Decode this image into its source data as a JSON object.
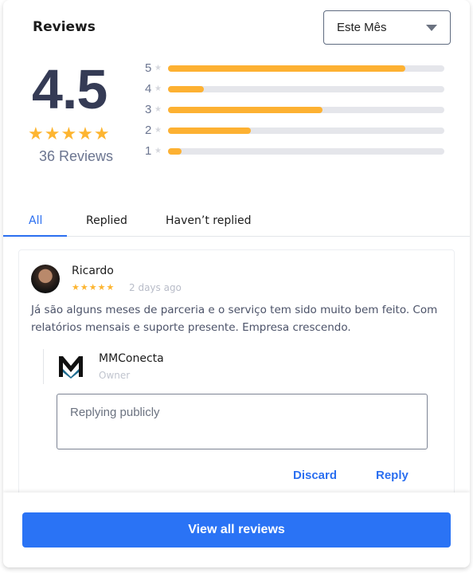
{
  "header": {
    "title": "Reviews",
    "period_select": "Este Mês"
  },
  "summary": {
    "rating": "4.5",
    "stars": "★★★★★",
    "count_label": "36 Reviews"
  },
  "distribution": [
    {
      "label": "5",
      "percent": 86
    },
    {
      "label": "4",
      "percent": 13
    },
    {
      "label": "3",
      "percent": 56
    },
    {
      "label": "2",
      "percent": 30
    },
    {
      "label": "1",
      "percent": 5
    }
  ],
  "tabs": [
    {
      "label": "All",
      "active": true
    },
    {
      "label": "Replied"
    },
    {
      "label": "Haven’t replied"
    }
  ],
  "review": {
    "name": "Ricardo",
    "stars": "★★★★★",
    "time": "2 days ago",
    "text": "Já são alguns meses de parceria e o serviço tem sido muito bem feito. Com relatórios mensais e suporte presente. Empresa crescendo.",
    "owner_name": "MMConecta",
    "owner_role": "Owner",
    "reply_placeholder": "Replying publicly",
    "discard_label": "Discard",
    "reply_label": "Reply"
  },
  "footer": {
    "view_all_label": "View all reviews"
  },
  "colors": {
    "accent": "#2a73f5",
    "star": "#fdb531",
    "bar_track": "#e5e6eb"
  }
}
